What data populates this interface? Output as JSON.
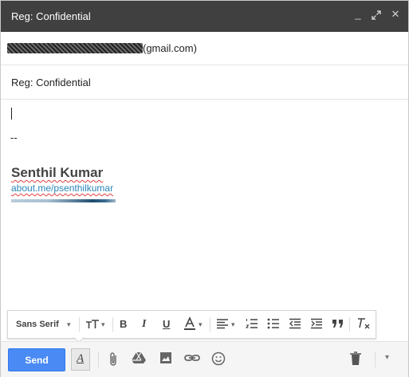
{
  "window": {
    "title": "Reg: Confidential",
    "controls": {
      "minimize": "_",
      "popout": "⤢",
      "close": "✕"
    }
  },
  "recipients": {
    "redacted_prefix": "",
    "visible_suffix": "(gmail.com)"
  },
  "subject": {
    "value": "Reg: Confidential"
  },
  "body": {
    "separator": "--",
    "signature_name": "Senthil Kumar",
    "signature_link": "about.me/psenthilkumar"
  },
  "format_toolbar": {
    "font_family": "Sans Serif",
    "items": [
      "font-size",
      "bold",
      "italic",
      "underline",
      "text-color",
      "align",
      "numbered-list",
      "bulleted-list",
      "indent-less",
      "indent-more",
      "quote",
      "remove-formatting"
    ]
  },
  "bottom_toolbar": {
    "send_label": "Send",
    "format_toggle_label": "A"
  },
  "colors": {
    "titlebar": "#404040",
    "send_button": "#4a8af4",
    "link": "#2a86b8",
    "spellcheck": "#e04040"
  }
}
